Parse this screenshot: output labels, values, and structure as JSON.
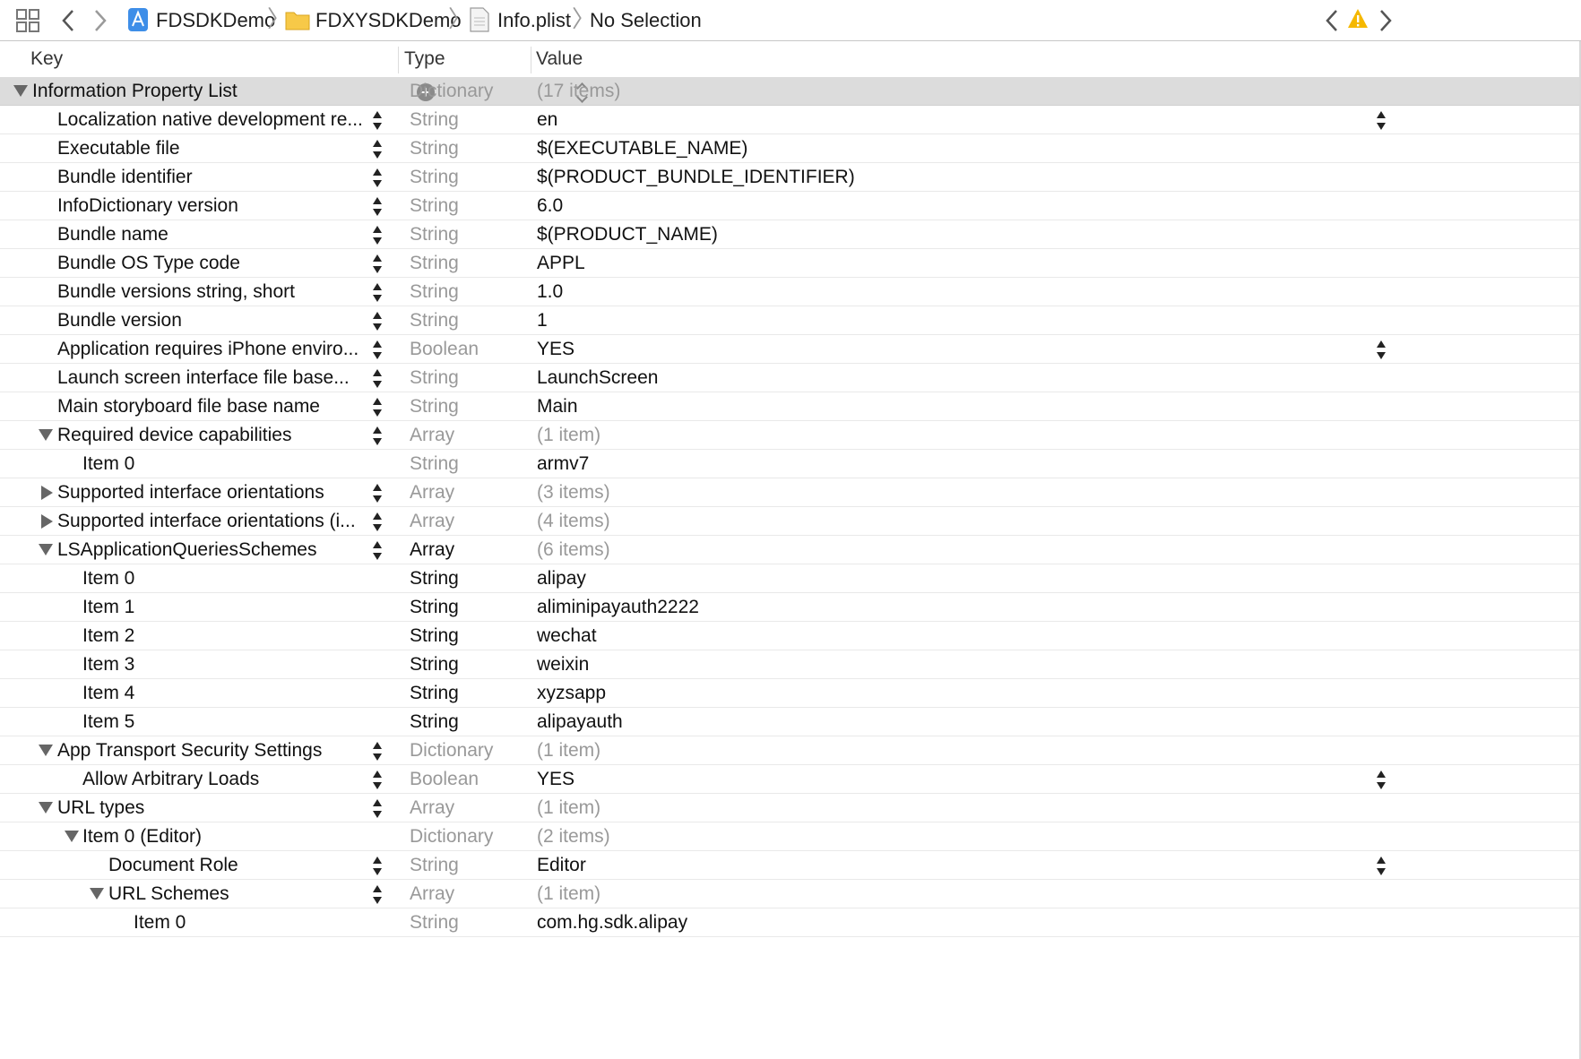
{
  "toolbar": {
    "icons": {
      "grid": "related-items-grid-icon",
      "back": "back-arrow-icon",
      "forward": "forward-arrow-icon",
      "app": "app-target-icon",
      "folder": "folder-icon",
      "plist": "plist-file-icon",
      "warning": "warning-icon"
    },
    "breadcrumb": {
      "project": "FDSDKDemo",
      "folder": "FDXYSDKDemo",
      "file": "Info.plist",
      "selection": "No Selection"
    },
    "warning_color": "#f5b800"
  },
  "columns": {
    "key": "Key",
    "type": "Type",
    "value": "Value"
  },
  "rows": [
    {
      "key": "Information Property List",
      "type": "Dictionary",
      "value": "(17 items)"
    },
    {
      "key": "Localization native development re...",
      "type": "String",
      "value": "en"
    },
    {
      "key": "Executable file",
      "type": "String",
      "value": "$(EXECUTABLE_NAME)"
    },
    {
      "key": "Bundle identifier",
      "type": "String",
      "value": "$(PRODUCT_BUNDLE_IDENTIFIER)"
    },
    {
      "key": "InfoDictionary version",
      "type": "String",
      "value": "6.0"
    },
    {
      "key": "Bundle name",
      "type": "String",
      "value": "$(PRODUCT_NAME)"
    },
    {
      "key": "Bundle OS Type code",
      "type": "String",
      "value": "APPL"
    },
    {
      "key": "Bundle versions string, short",
      "type": "String",
      "value": "1.0"
    },
    {
      "key": "Bundle version",
      "type": "String",
      "value": "1"
    },
    {
      "key": "Application requires iPhone enviro...",
      "type": "Boolean",
      "value": "YES"
    },
    {
      "key": "Launch screen interface file base...",
      "type": "String",
      "value": "LaunchScreen"
    },
    {
      "key": "Main storyboard file base name",
      "type": "String",
      "value": "Main"
    },
    {
      "key": "Required device capabilities",
      "type": "Array",
      "value": "(1 item)"
    },
    {
      "key": "Item 0",
      "type": "String",
      "value": "armv7"
    },
    {
      "key": "Supported interface orientations",
      "type": "Array",
      "value": "(3 items)"
    },
    {
      "key": "Supported interface orientations (i...",
      "type": "Array",
      "value": "(4 items)"
    },
    {
      "key": "LSApplicationQueriesSchemes",
      "type": "Array",
      "value": "(6 items)"
    },
    {
      "key": "Item 0",
      "type": "String",
      "value": "alipay"
    },
    {
      "key": "Item 1",
      "type": "String",
      "value": "aliminipayauth2222"
    },
    {
      "key": "Item 2",
      "type": "String",
      "value": "wechat"
    },
    {
      "key": "Item 3",
      "type": "String",
      "value": "weixin"
    },
    {
      "key": "Item 4",
      "type": "String",
      "value": "xyzsapp"
    },
    {
      "key": "Item 5",
      "type": "String",
      "value": "alipayauth"
    },
    {
      "key": "App Transport Security Settings",
      "type": "Dictionary",
      "value": "(1 item)"
    },
    {
      "key": "Allow Arbitrary Loads",
      "type": "Boolean",
      "value": "YES"
    },
    {
      "key": "URL types",
      "type": "Array",
      "value": "(1 item)"
    },
    {
      "key": "Item 0 (Editor)",
      "type": "Dictionary",
      "value": "(2 items)"
    },
    {
      "key": "Document Role",
      "type": "String",
      "value": "Editor"
    },
    {
      "key": "URL Schemes",
      "type": "Array",
      "value": "(1 item)"
    },
    {
      "key": "Item 0",
      "type": "String",
      "value": "com.hg.sdk.alipay"
    }
  ]
}
